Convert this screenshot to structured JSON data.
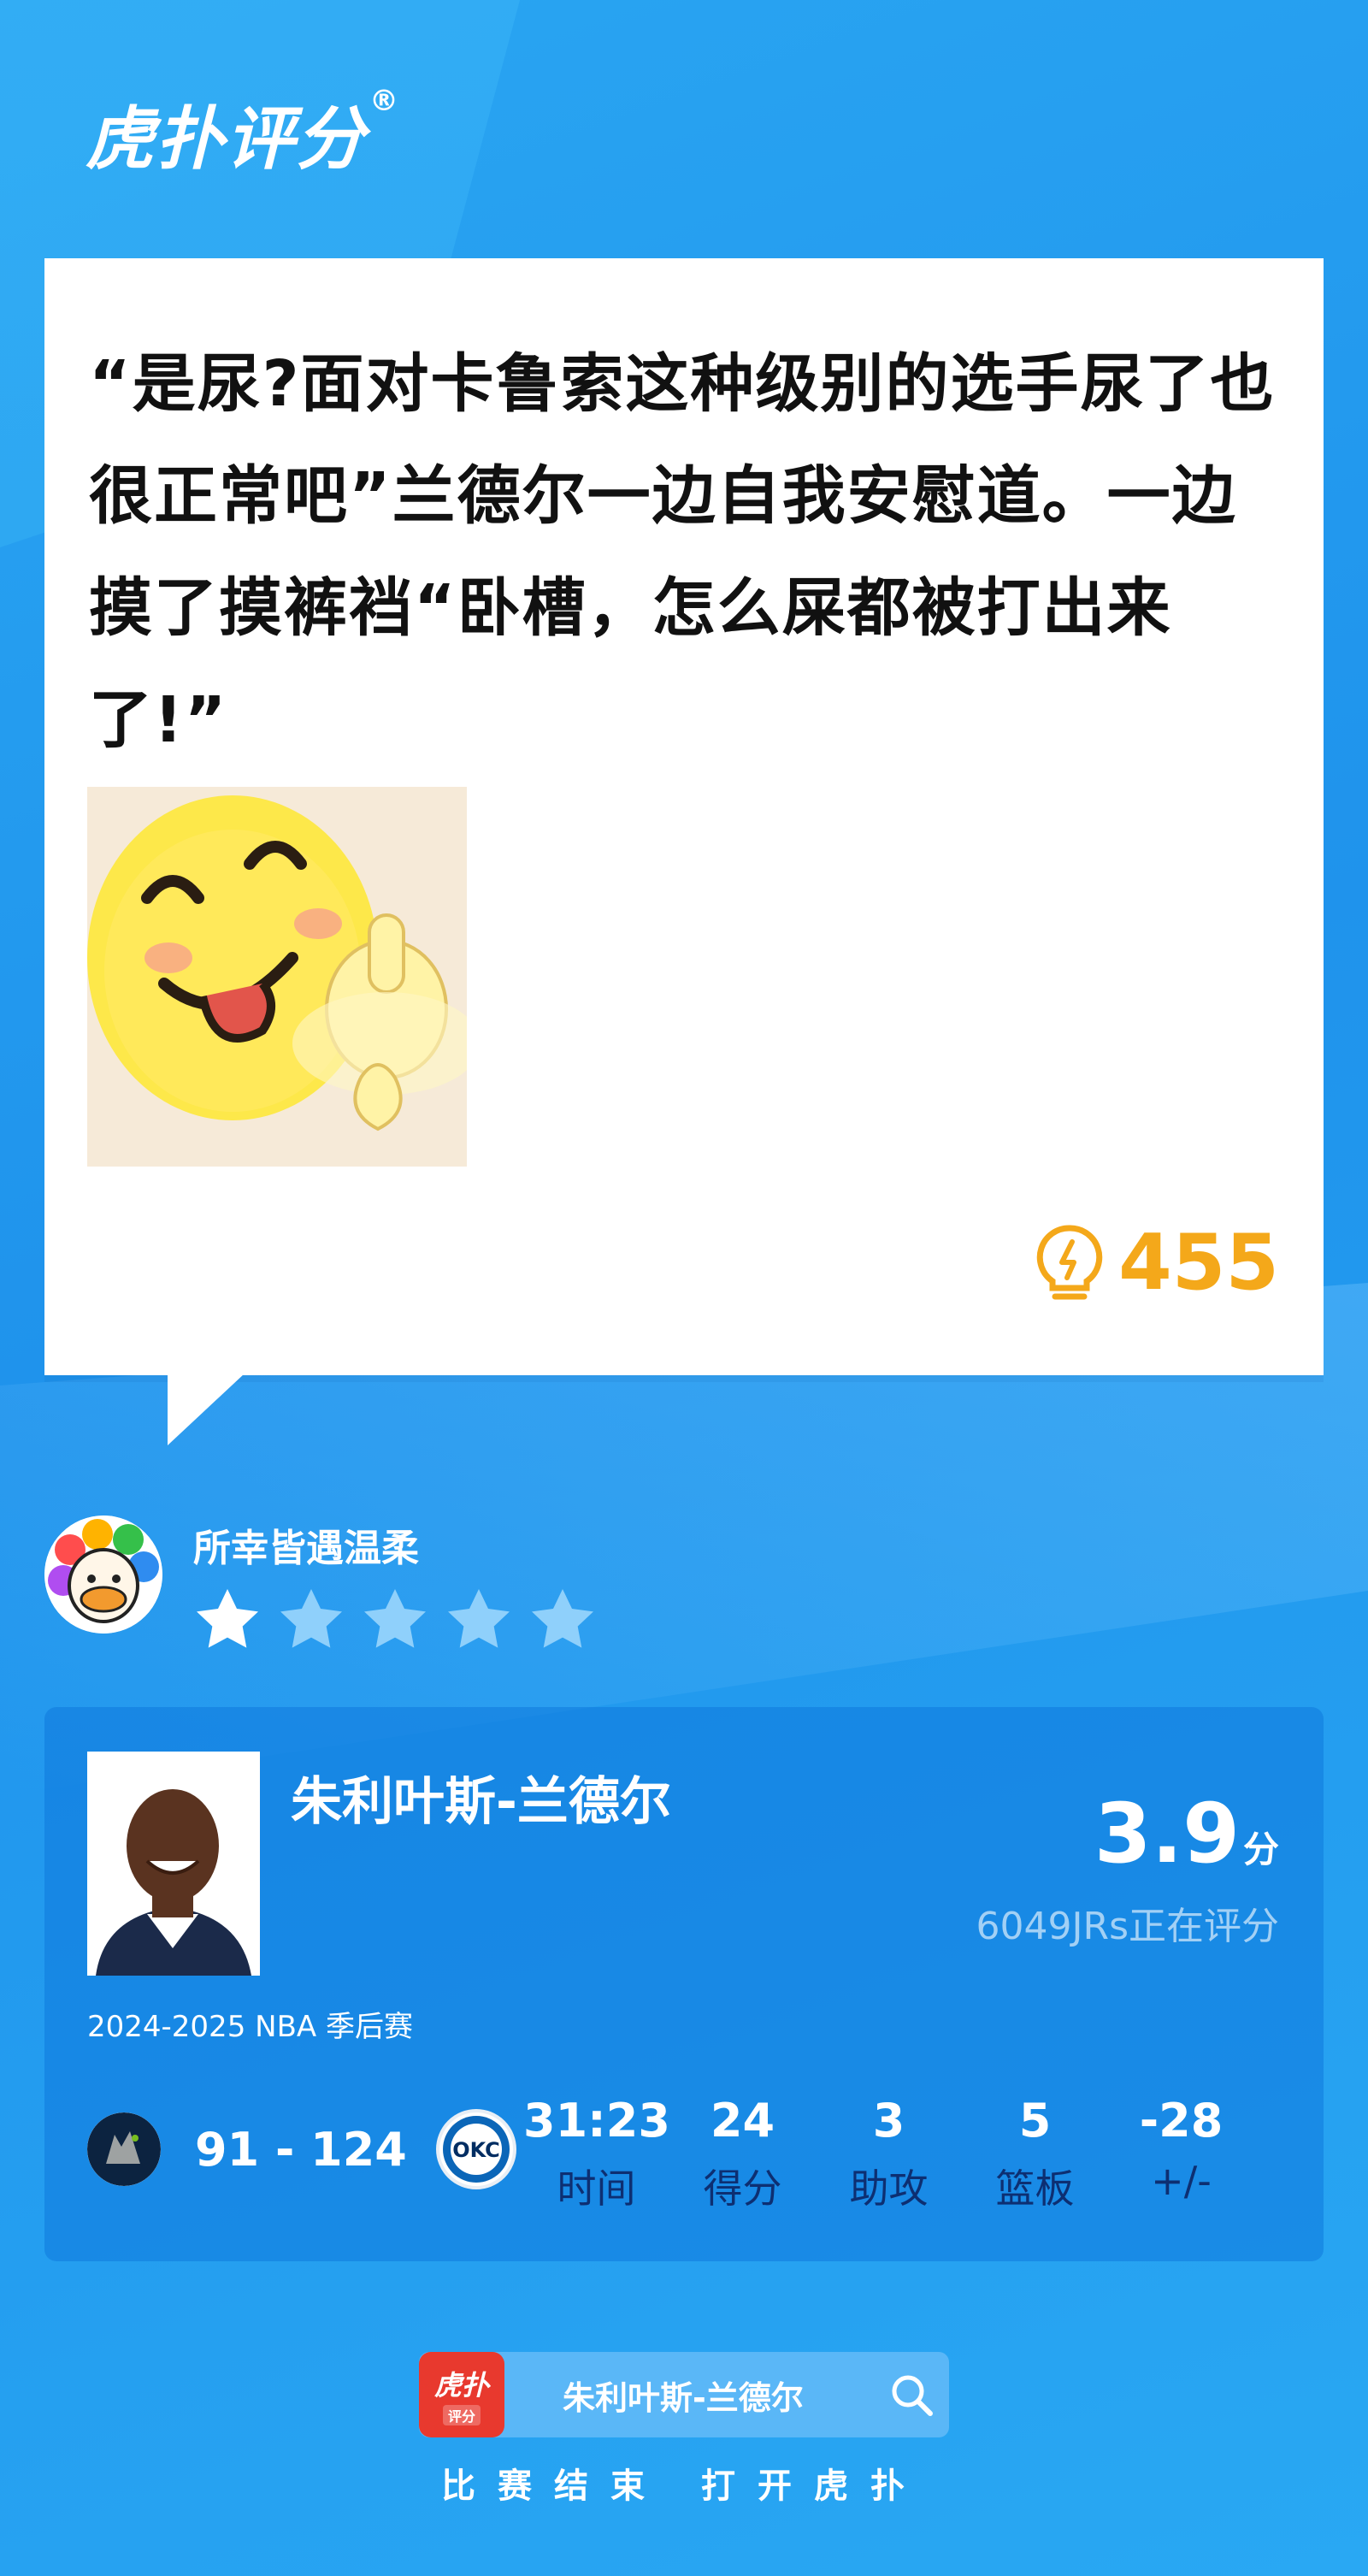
{
  "brand": {
    "logo_text": "虎扑评分",
    "logo_mark": "®"
  },
  "comment": {
    "text": "“是尿?面对卡鲁索这种级别的选手尿了也很正常吧”兰德尔一边自我安慰道。一边摸了摸裤裆“卧槽，怎么屎都被打出来了!”",
    "like_count": "455"
  },
  "user": {
    "name": "所幸皆遇温柔",
    "rating_stars": 1,
    "max_stars": 5
  },
  "player": {
    "name": "朱利叶斯-兰德尔",
    "score": "3.9",
    "score_unit": "分",
    "raters": "6049JRs正在评分",
    "season": "2024-2025 NBA 季后赛",
    "match_score": "91 - 124",
    "away_team_logo_text": "OKC",
    "stats": [
      {
        "value": "31:23",
        "label": "时间"
      },
      {
        "value": "24",
        "label": "得分"
      },
      {
        "value": "3",
        "label": "助攻"
      },
      {
        "value": "5",
        "label": "篮板"
      },
      {
        "value": "-28",
        "label": "+/-"
      }
    ]
  },
  "footer": {
    "app_icon_text": "虎扑",
    "app_icon_sub": "评分",
    "search_text": "朱利叶斯-兰德尔",
    "bottom_text": "比赛结束 打开虎扑"
  },
  "colors": {
    "accent_blue": "#1f93ec",
    "like_orange": "#f4a81a",
    "label_navy": "#0d2f72"
  },
  "icons": [
    "lightbulb-icon",
    "star-icon",
    "search-icon",
    "timberwolves-logo",
    "thunder-logo"
  ]
}
